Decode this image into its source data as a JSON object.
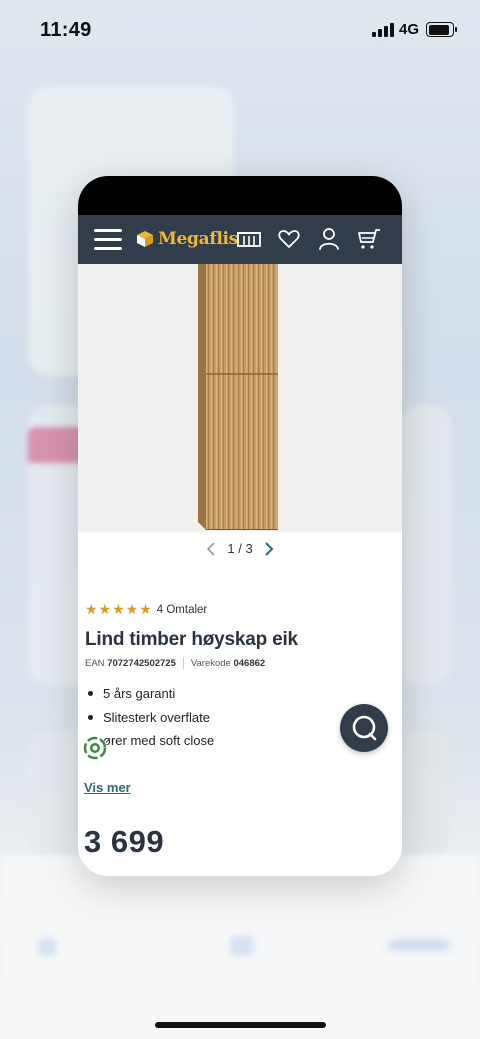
{
  "status_bar": {
    "time": "11:49",
    "network": "4G",
    "icons": [
      "signal-icon",
      "battery-icon"
    ]
  },
  "app": {
    "navbar": {
      "logo_text": "Megaflis",
      "icons": [
        "menu-icon",
        "store-icon",
        "heart-icon",
        "user-icon",
        "cart-icon"
      ]
    },
    "gallery": {
      "current": "1",
      "separator": "/",
      "total": "3"
    },
    "product": {
      "stars": "★★★★★",
      "rating_value": 5,
      "reviews": "4 Omtaler",
      "title": "Lind timber høyskap eik",
      "ean_label": "EAN",
      "ean_value": "7072742502725",
      "code_label": "Varekode",
      "code_value": "046862",
      "features": [
        "5 års garanti",
        "Slitesterk overflate",
        "ører med soft close"
      ],
      "read_more": "Vis mer",
      "price": "3 699"
    },
    "chat_button": "chat-icon"
  },
  "colors": {
    "navbar": "#323d4c",
    "logo": "#f2b632",
    "stars": "#e29a1b",
    "link": "#2b6a6e",
    "text_dark": "#2a3441",
    "eco_green": "#3a8a3e"
  }
}
